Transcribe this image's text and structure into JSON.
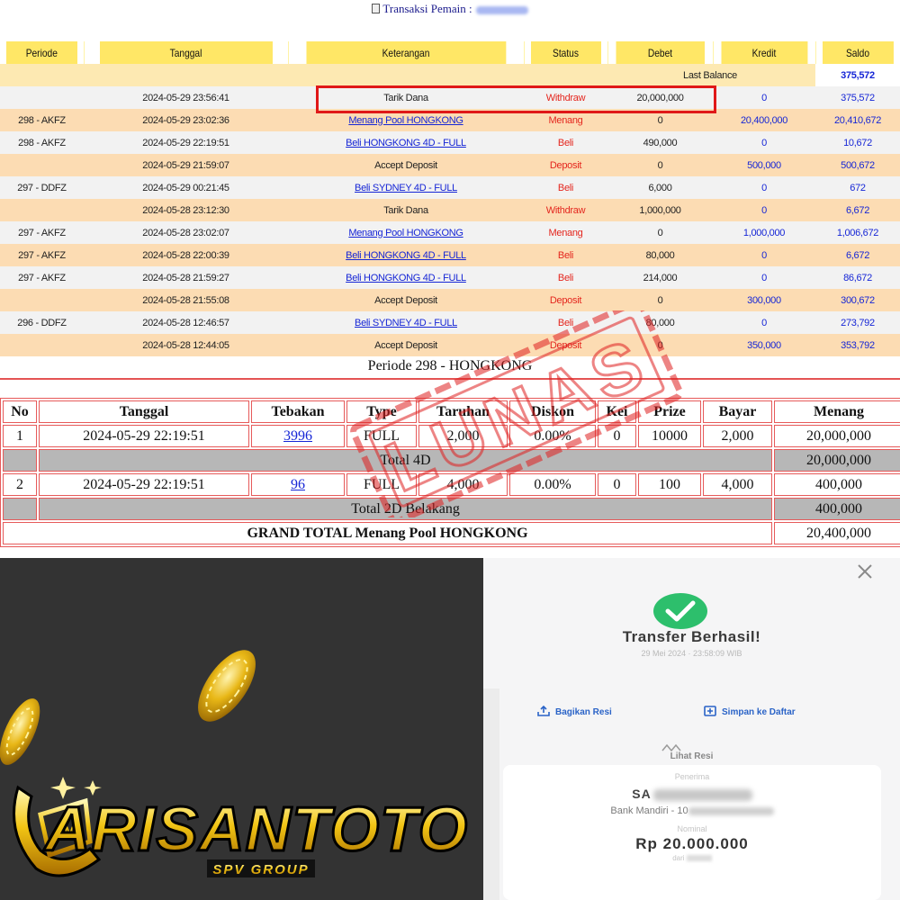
{
  "header": {
    "title": "Transaksi  Pemain :"
  },
  "ledger": {
    "columns": [
      "Periode",
      "Tanggal",
      "Keterangan",
      "Status",
      "Debet",
      "Kredit",
      "Saldo"
    ],
    "last_balance_label": "Last Balance",
    "last_balance_value": "375,572",
    "rows": [
      {
        "periode": "",
        "tanggal": "2024-05-29 23:56:41",
        "ket": "Tarik Dana",
        "link": false,
        "status": "Withdraw",
        "debet": "20,000,000",
        "kredit": "0",
        "saldo": "375,572"
      },
      {
        "periode": "298 - AKFZ",
        "tanggal": "2024-05-29 23:02:36",
        "ket": "Menang Pool HONGKONG",
        "link": true,
        "status": "Menang",
        "debet": "0",
        "kredit": "20,400,000",
        "saldo": "20,410,672"
      },
      {
        "periode": "298 - AKFZ",
        "tanggal": "2024-05-29 22:19:51",
        "ket": "Beli HONGKONG 4D - FULL",
        "link": true,
        "status": "Beli",
        "debet": "490,000",
        "kredit": "0",
        "saldo": "10,672"
      },
      {
        "periode": "",
        "tanggal": "2024-05-29 21:59:07",
        "ket": "Accept Deposit",
        "link": false,
        "status": "Deposit",
        "debet": "0",
        "kredit": "500,000",
        "saldo": "500,672"
      },
      {
        "periode": "297 - DDFZ",
        "tanggal": "2024-05-29 00:21:45",
        "ket": "Beli SYDNEY 4D - FULL",
        "link": true,
        "status": "Beli",
        "debet": "6,000",
        "kredit": "0",
        "saldo": "672"
      },
      {
        "periode": "",
        "tanggal": "2024-05-28 23:12:30",
        "ket": "Tarik Dana",
        "link": false,
        "status": "Withdraw",
        "debet": "1,000,000",
        "kredit": "0",
        "saldo": "6,672"
      },
      {
        "periode": "297 - AKFZ",
        "tanggal": "2024-05-28 23:02:07",
        "ket": "Menang Pool HONGKONG",
        "link": true,
        "status": "Menang",
        "debet": "0",
        "kredit": "1,000,000",
        "saldo": "1,006,672"
      },
      {
        "periode": "297 - AKFZ",
        "tanggal": "2024-05-28 22:00:39",
        "ket": "Beli HONGKONG 4D - FULL",
        "link": true,
        "status": "Beli",
        "debet": "80,000",
        "kredit": "0",
        "saldo": "6,672"
      },
      {
        "periode": "297 - AKFZ",
        "tanggal": "2024-05-28 21:59:27",
        "ket": "Beli HONGKONG 4D - FULL",
        "link": true,
        "status": "Beli",
        "debet": "214,000",
        "kredit": "0",
        "saldo": "86,672"
      },
      {
        "periode": "",
        "tanggal": "2024-05-28 21:55:08",
        "ket": "Accept Deposit",
        "link": false,
        "status": "Deposit",
        "debet": "0",
        "kredit": "300,000",
        "saldo": "300,672"
      },
      {
        "periode": "296 - DDFZ",
        "tanggal": "2024-05-28 12:46:57",
        "ket": "Beli SYDNEY 4D - FULL",
        "link": true,
        "status": "Beli",
        "debet": "80,000",
        "kredit": "0",
        "saldo": "273,792"
      },
      {
        "periode": "",
        "tanggal": "2024-05-28 12:44:05",
        "ket": "Accept Deposit",
        "link": false,
        "status": "Deposit",
        "debet": "0",
        "kredit": "350,000",
        "saldo": "353,792"
      }
    ]
  },
  "periode_title": "Periode 298 - HONGKONG",
  "bets": {
    "columns": [
      "No",
      "Tanggal",
      "Tebakan",
      "Type",
      "Taruhan",
      "Diskon",
      "Kei",
      "Prize",
      "Bayar",
      "Menang"
    ],
    "rows": [
      {
        "no": "1",
        "tanggal": "2024-05-29 22:19:51",
        "tebakan": "3996",
        "type": "FULL",
        "taruhan": "2,000",
        "diskon": "0.00%",
        "kei": "0",
        "prize": "10000",
        "bayar": "2,000",
        "menang": "20,000,000"
      },
      {
        "no": "2",
        "tanggal": "2024-05-29 22:19:51",
        "tebakan": "96",
        "type": "FULL",
        "taruhan": "4,000",
        "diskon": "0.00%",
        "kei": "0",
        "prize": "100",
        "bayar": "4,000",
        "menang": "400,000"
      }
    ],
    "total_4d_label": "Total 4D",
    "total_4d_value": "20,000,000",
    "total_2d_label": "Total 2D Belakang",
    "total_2d_value": "400,000",
    "grand_label": "GRAND TOTAL  Menang Pool HONGKONG",
    "grand_value": "20,400,000"
  },
  "stamp": {
    "text": "LUNAS",
    "color": "#e02020"
  },
  "brand": {
    "name": "ARISANTOTO",
    "tagline": "SPV GROUP",
    "gold": "#f2c514"
  },
  "receipt": {
    "title": "Transfer Berhasil!",
    "timestamp": "29 Mei 2024 · 23:58:09 WIB",
    "lihat_resi": "Lihat Resi",
    "penerima_label": "Penerima",
    "recipient_name_visible": "SA",
    "bank": "Bank Mandiri - 10",
    "nominal_label": "Nominal",
    "amount": "Rp 20.000.000",
    "dari_label": "dari",
    "share_label": "Bagikan Resi",
    "save_label": "Simpan ke Daftar",
    "success_color": "#2dbf6c"
  }
}
